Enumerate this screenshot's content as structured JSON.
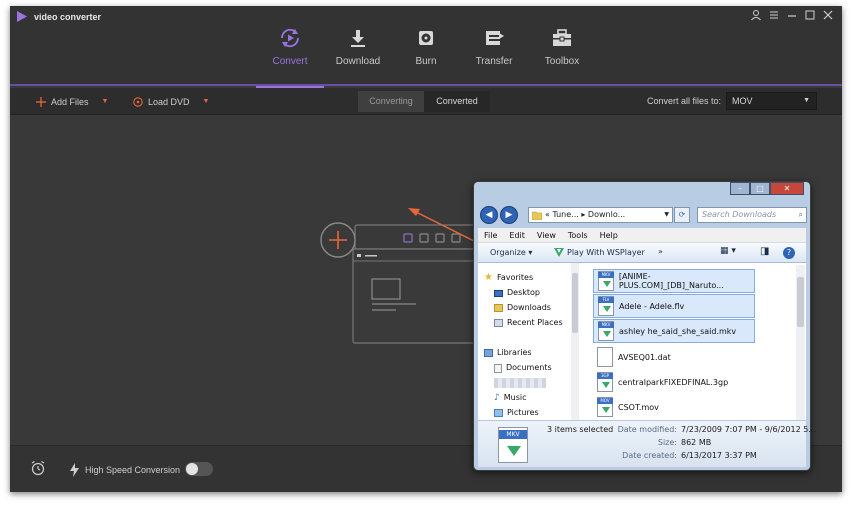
{
  "app": {
    "title": "video converter",
    "accent": "#9b74e2",
    "orange": "#e9663a",
    "window_controls": [
      "user-icon",
      "menu-icon",
      "minimize-icon",
      "maximize-icon",
      "close-icon"
    ]
  },
  "nav": {
    "items": [
      {
        "label": "Convert",
        "icon": "convert-icon",
        "active": true
      },
      {
        "label": "Download",
        "icon": "download-icon"
      },
      {
        "label": "Burn",
        "icon": "burn-icon"
      },
      {
        "label": "Transfer",
        "icon": "transfer-icon"
      },
      {
        "label": "Toolbox",
        "icon": "toolbox-icon"
      }
    ]
  },
  "toolbar": {
    "add_files": "Add Files",
    "load_dvd": "Load DVD",
    "tabs": [
      "Converting",
      "Converted"
    ],
    "convert_all_label": "Convert all files to:",
    "format": "MOV"
  },
  "bottom": {
    "high_speed": "High Speed Conversion",
    "high_speed_on": false
  },
  "explorer": {
    "address": [
      "Tune...",
      "Downlo..."
    ],
    "search_placeholder": "Search Downloads",
    "menu": [
      "File",
      "Edit",
      "View",
      "Tools",
      "Help"
    ],
    "commands": {
      "organize": "Organize",
      "play": "Play With WSPlayer",
      "more": "»"
    },
    "nav_pane": {
      "favorites": "Favorites",
      "favorites_items": [
        "Desktop",
        "Downloads",
        "Recent Places"
      ],
      "libraries": "Libraries",
      "libraries_items": [
        "Documents",
        "",
        "Music",
        "Pictures"
      ]
    },
    "files": [
      {
        "name": "[ANIME-PLUS.COM]_[DB]_Naruto...",
        "badge": "MKV",
        "selected": true
      },
      {
        "name": "Adele - Adele.flv",
        "badge": "FLV",
        "selected": true
      },
      {
        "name": "ashley he_said_she_said.mkv",
        "badge": "MKV",
        "selected": true
      },
      {
        "name": "AVSEQ01.dat",
        "badge": "",
        "selected": false
      },
      {
        "name": "centralparkFIXEDFINAL.3gp",
        "badge": "3GP",
        "selected": false
      },
      {
        "name": "CSOT.mov",
        "badge": "MOV",
        "selected": false
      }
    ],
    "details": {
      "badge": "MKV",
      "count_text": "3 items selected",
      "date_modified_label": "Date modified:",
      "date_modified": "7/23/2009 7:07 PM - 9/6/2012 5...",
      "size_label": "Size:",
      "size": "862 MB",
      "date_created_label": "Date created:",
      "date_created": "6/13/2017 3:37 PM"
    }
  }
}
